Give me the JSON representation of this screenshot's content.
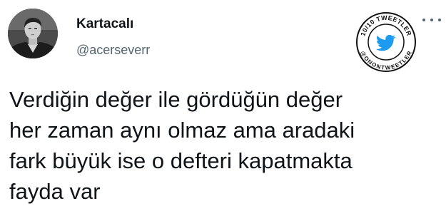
{
  "user": {
    "display_name": "Kartacalı",
    "username": "@acerseverr"
  },
  "badge": {
    "top_text": "10/10 TWEETLER",
    "bottom_text": "@ONONTWEETLER",
    "icon": "twitter-bird-icon",
    "color": "#1d9bf0"
  },
  "more_icon": "more-dots-icon",
  "tweet": {
    "lines": [
      "Verdiğin değer ile gördüğün değer",
      "her zaman aynı olmaz ama aradaki",
      "fark büyük ise o defteri kapatmakta",
      "fayda var"
    ]
  }
}
